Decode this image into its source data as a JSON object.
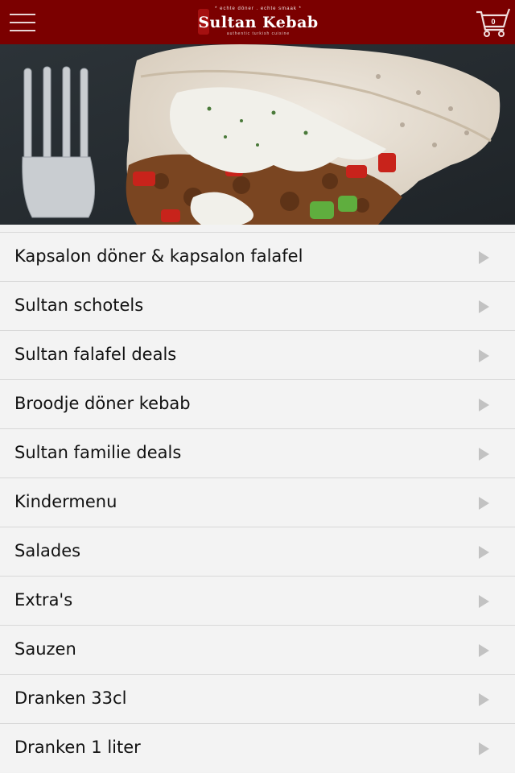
{
  "header": {
    "menu_icon": "hamburger-menu-icon",
    "logo": {
      "tagline": "* echte döner . echte smaak *",
      "name": "Sultan Kebab",
      "subtitle": "authentic turkish cuisine"
    },
    "cart": {
      "icon": "shopping-cart-icon",
      "count": "0"
    },
    "background": "#7b0000"
  },
  "hero": {
    "image": "döner kebab in pita bread with garlic sauce and a fork"
  },
  "menu": {
    "items": [
      {
        "label": "Kapsalon döner & kapsalon falafel"
      },
      {
        "label": "Sultan schotels"
      },
      {
        "label": "Sultan falafel deals"
      },
      {
        "label": "Broodje döner kebab"
      },
      {
        "label": "Sultan familie deals"
      },
      {
        "label": "Kindermenu"
      },
      {
        "label": "Salades"
      },
      {
        "label": "Extra's"
      },
      {
        "label": "Sauzen"
      },
      {
        "label": "Dranken 33cl"
      },
      {
        "label": "Dranken 1 liter"
      }
    ],
    "arrow_icon": "chevron-right-icon"
  }
}
